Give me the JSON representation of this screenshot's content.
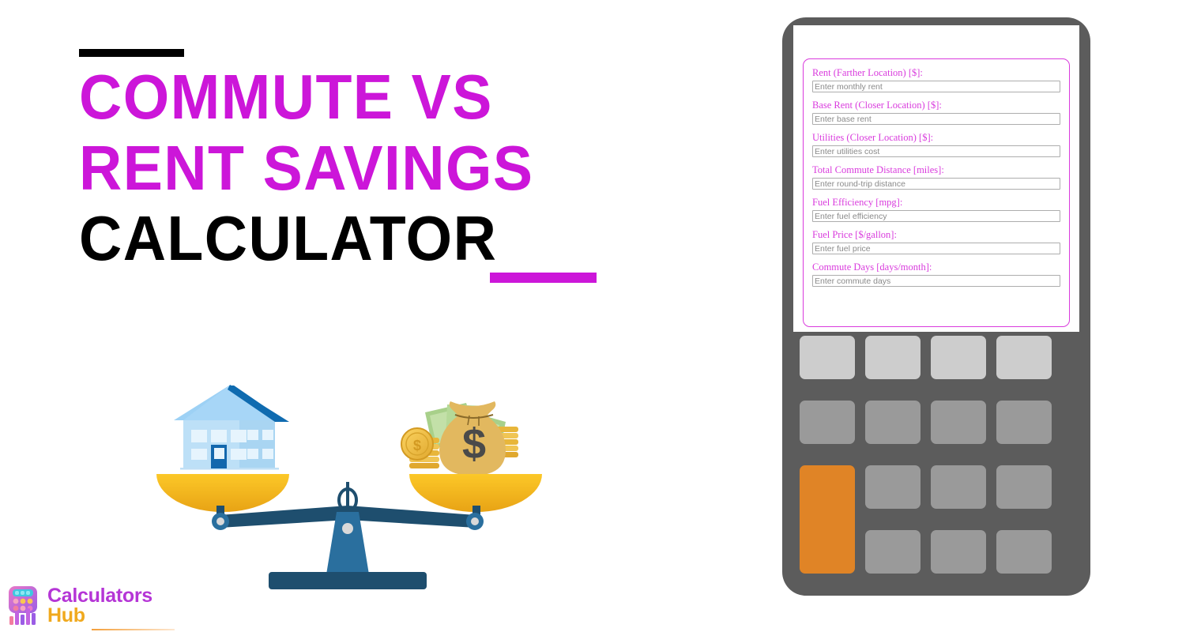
{
  "title": {
    "line1": "Commute vs",
    "line2": "Rent Savings",
    "line3": "Calculator",
    "accent_color_magenta": "#cc16d9",
    "accent_color_black": "#000000"
  },
  "illustration": {
    "name": "balance-scale-house-vs-money",
    "left_item": "house",
    "right_item": "money-bag-with-coins",
    "dollar_symbol": "$",
    "coin_symbol": "$"
  },
  "logo": {
    "word1": "Calculators",
    "word2": "Hub",
    "word1_color": "#b535d6",
    "word2_color": "#f0a91e"
  },
  "calculator": {
    "body_color": "#5c5c5c",
    "accent_key_color": "#e08426",
    "form": {
      "border_color": "#d93bdd",
      "fields": [
        {
          "label": "Rent (Farther Location) [$]:",
          "placeholder": "Enter monthly rent",
          "value": ""
        },
        {
          "label": "Base Rent (Closer Location) [$]:",
          "placeholder": "Enter base rent",
          "value": ""
        },
        {
          "label": "Utilities (Closer Location) [$]:",
          "placeholder": "Enter utilities cost",
          "value": ""
        },
        {
          "label": "Total Commute Distance [miles]:",
          "placeholder": "Enter round-trip distance",
          "value": ""
        },
        {
          "label": "Fuel Efficiency [mpg]:",
          "placeholder": "Enter fuel efficiency",
          "value": ""
        },
        {
          "label": "Fuel Price [$/gallon]:",
          "placeholder": "Enter fuel price",
          "value": ""
        },
        {
          "label": "Commute Days [days/month]:",
          "placeholder": "Enter commute days",
          "value": ""
        }
      ]
    },
    "keypad": {
      "rows": 4,
      "columns": 4,
      "keys_blank": true
    }
  }
}
